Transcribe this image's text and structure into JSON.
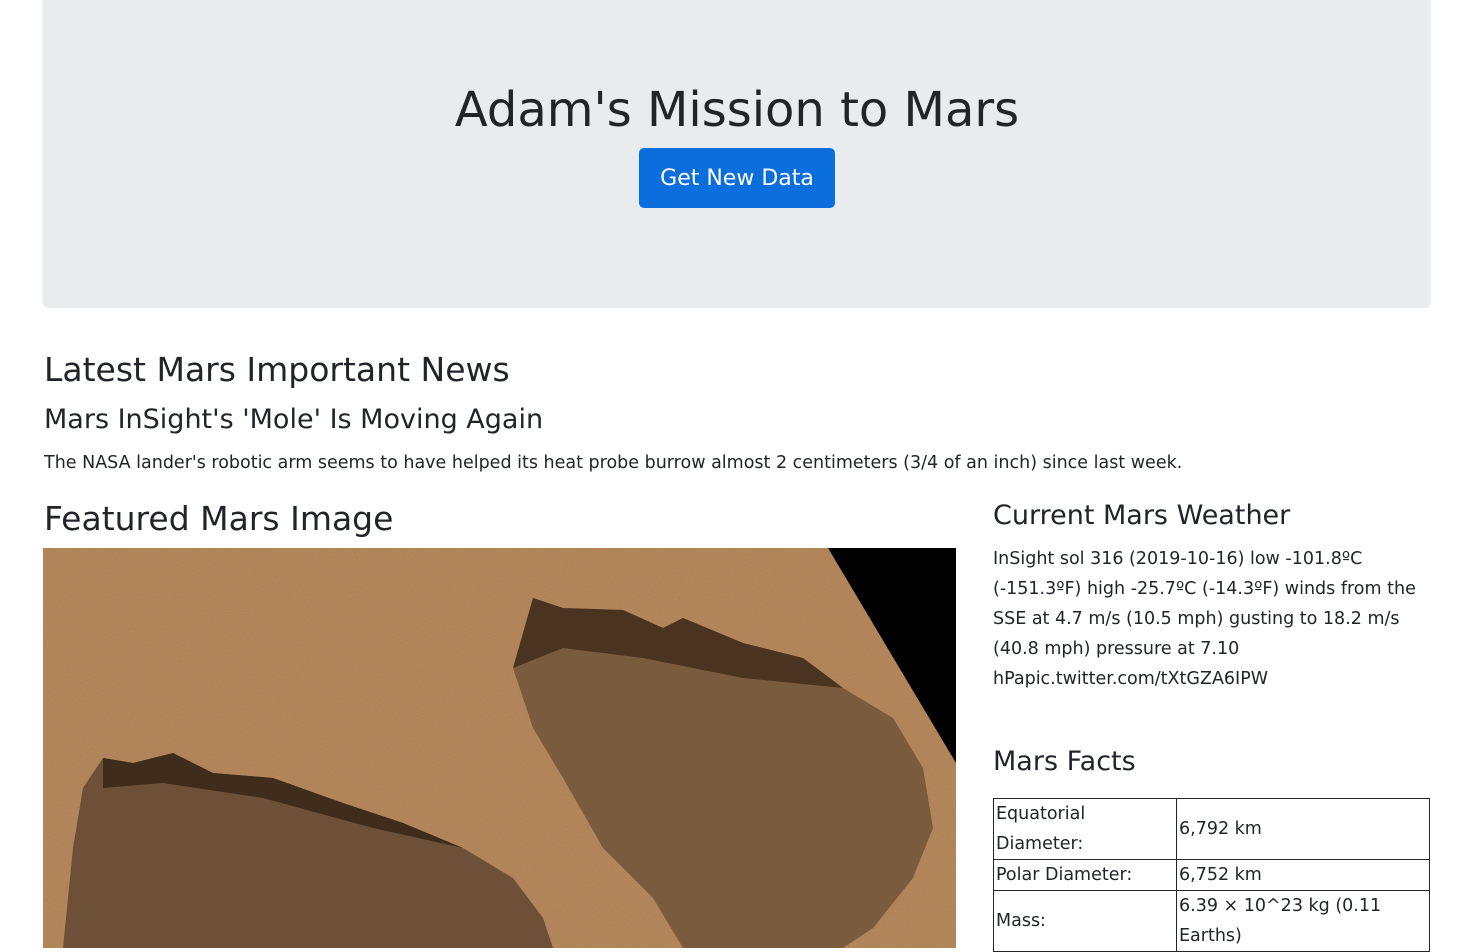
{
  "header": {
    "title": "Adam's Mission to Mars",
    "button_label": "Get New Data"
  },
  "news": {
    "heading": "Latest Mars Important News",
    "title": "Mars InSight's 'Mole' Is Moving Again",
    "paragraph": "The NASA lander's robotic arm seems to have helped its heat probe burrow almost 2 centimeters (3/4 of an inch) since last week."
  },
  "featured": {
    "heading": "Featured Mars Image"
  },
  "weather": {
    "heading": "Current Mars Weather",
    "text": "InSight sol 316 (2019-10-16) low -101.8ºC (-151.3ºF) high -25.7ºC (-14.3ºF) winds from the SSE at 4.7 m/s (10.5 mph) gusting to 18.2 m/s (40.8 mph) pressure at 7.10 hPapic.twitter.com/tXtGZA6IPW"
  },
  "facts": {
    "heading": "Mars Facts",
    "rows": [
      {
        "label": "Equatorial Diameter:",
        "value": "6,792 km"
      },
      {
        "label": "Polar Diameter:",
        "value": "6,752 km"
      },
      {
        "label": "Mass:",
        "value": "6.39 × 10^23 kg (0.11 Earths)"
      }
    ]
  }
}
